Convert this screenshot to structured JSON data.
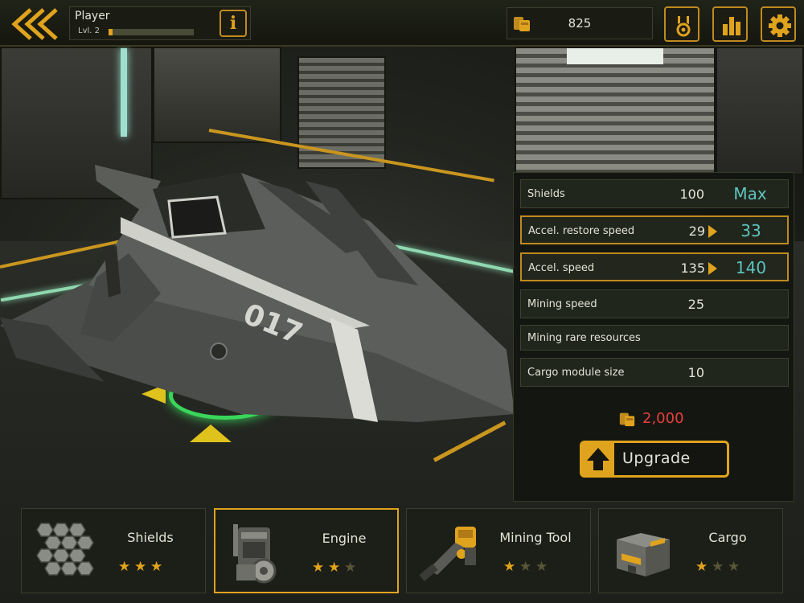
{
  "topbar": {
    "player_name": "Player",
    "level": "Lvl. 2",
    "xp_progress": 0.05,
    "info_glyph": "i",
    "coins": "825",
    "buttons": [
      "medal-icon",
      "stats-icon",
      "settings-icon"
    ]
  },
  "stats": [
    {
      "label": "Shields",
      "current": "100",
      "next": "Max",
      "upgradable": false
    },
    {
      "label": "Accel. restore speed",
      "current": "29",
      "next": "33",
      "upgradable": true
    },
    {
      "label": "Accel. speed",
      "current": "135",
      "next": "140",
      "upgradable": true
    },
    {
      "label": "Mining speed",
      "current": "25",
      "next": "",
      "upgradable": false
    },
    {
      "label": "Mining rare resources",
      "current": "",
      "next": "",
      "upgradable": false
    },
    {
      "label": "Cargo module size",
      "current": "10",
      "next": "",
      "upgradable": false
    }
  ],
  "upgrade": {
    "cost": "2,000",
    "button_label": "Upgrade"
  },
  "modules": [
    {
      "name": "Shields",
      "stars": 3,
      "max_stars": 3,
      "selected": false
    },
    {
      "name": "Engine",
      "stars": 2,
      "max_stars": 3,
      "selected": true
    },
    {
      "name": "Mining Tool",
      "stars": 1,
      "max_stars": 3,
      "selected": false
    },
    {
      "name": "Cargo",
      "stars": 1,
      "max_stars": 3,
      "selected": false
    }
  ],
  "ship": {
    "hull_number": "017"
  },
  "colors": {
    "accent": "#e0a31d",
    "upgrade_value": "#5ec4c0",
    "cost": "#e8403c",
    "star_empty": "#5a5538"
  }
}
